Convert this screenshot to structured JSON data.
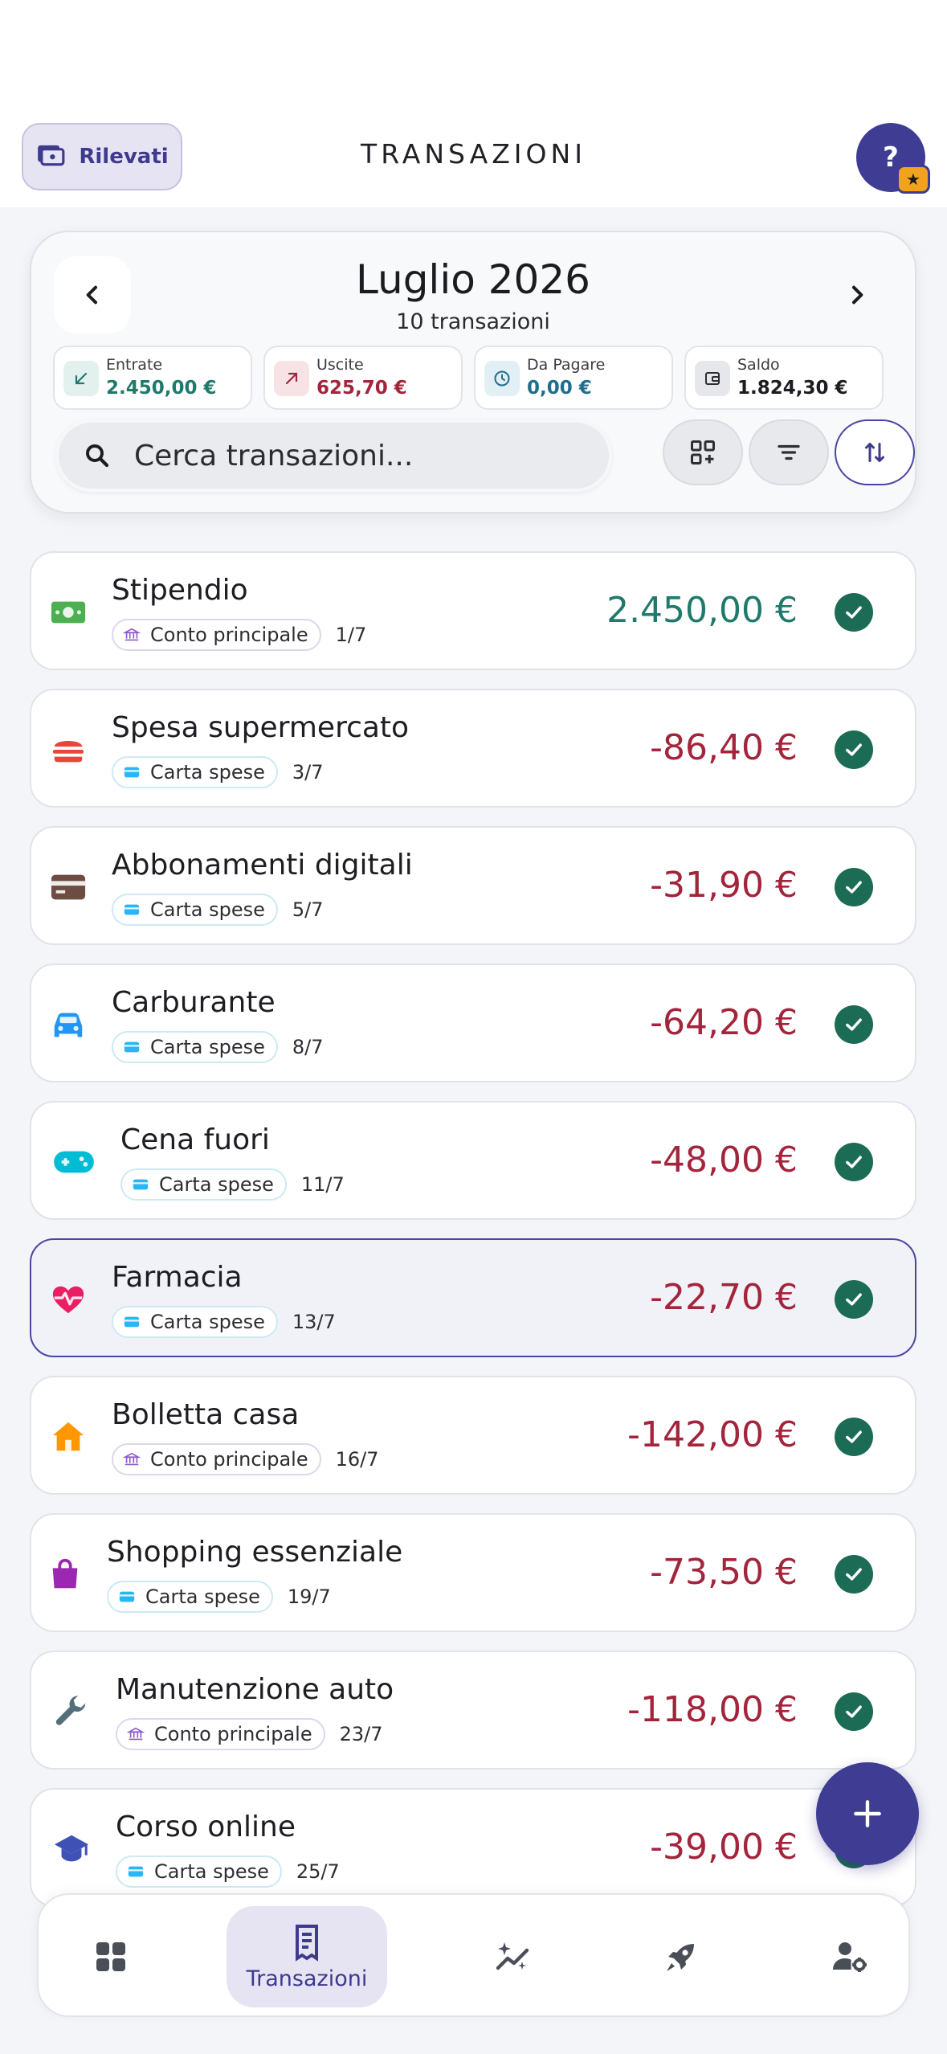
{
  "header": {
    "rilevati_label": "Rilevati",
    "title": "TRANSAZIONI",
    "help_label": "?",
    "help_badge": "★"
  },
  "month": {
    "title": "Luglio 2026",
    "subtitle": "10 transazioni",
    "stats": [
      {
        "label": "Entrate",
        "value": "2.450,00 €",
        "color": "#1f7a6b"
      },
      {
        "label": "Uscite",
        "value": "625,70 €",
        "color": "#a3243b"
      },
      {
        "label": "Da Pagare",
        "value": "0,00 €",
        "color": "#1f6f8b"
      },
      {
        "label": "Saldo",
        "value": "1.824,30 €",
        "color": "#1c1c22"
      }
    ]
  },
  "search": {
    "placeholder": "Cerca transazioni..."
  },
  "transactions": [
    {
      "name": "Stipendio",
      "account": "Conto principale",
      "account_type": "bank",
      "date": "1/7",
      "amount": "2.450,00 €",
      "icon": "banknote-icon",
      "color": "#4caf50"
    },
    {
      "name": "Spesa supermercato",
      "account": "Carta spese",
      "account_type": "card",
      "date": "3/7",
      "amount": "-86,40 €",
      "icon": "burger-icon",
      "color": "#e8453c"
    },
    {
      "name": "Abbonamenti digitali",
      "account": "Carta spese",
      "account_type": "card",
      "date": "5/7",
      "amount": "-31,90 €",
      "icon": "credit-card-icon",
      "color": "#6d4c41"
    },
    {
      "name": "Carburante",
      "account": "Carta spese",
      "account_type": "card",
      "date": "8/7",
      "amount": "-64,20 €",
      "icon": "car-icon",
      "color": "#2196f3"
    },
    {
      "name": "Cena fuori",
      "account": "Carta spese",
      "account_type": "card",
      "date": "11/7",
      "amount": "-48,00 €",
      "icon": "gamepad-icon",
      "color": "#00bcd4"
    },
    {
      "name": "Farmacia",
      "account": "Carta spese",
      "account_type": "card",
      "date": "13/7",
      "amount": "-22,70 €",
      "icon": "heart-pulse-icon",
      "color": "#e91e63"
    },
    {
      "name": "Bolletta casa",
      "account": "Conto principale",
      "account_type": "bank",
      "date": "16/7",
      "amount": "-142,00 €",
      "icon": "house-icon",
      "color": "#ff9800"
    },
    {
      "name": "Shopping essenziale",
      "account": "Carta spese",
      "account_type": "card",
      "date": "19/7",
      "amount": "-73,50 €",
      "icon": "shopping-bag-icon",
      "color": "#9c27b0"
    },
    {
      "name": "Manutenzione auto",
      "account": "Conto principale",
      "account_type": "bank",
      "date": "23/7",
      "amount": "-118,00 €",
      "icon": "wrench-icon",
      "color": "#546e7a"
    },
    {
      "name": "Corso online",
      "account": "Carta spese",
      "account_type": "card",
      "date": "25/7",
      "amount": "-39,00 €",
      "icon": "graduation-cap-icon",
      "color": "#3f51b5"
    }
  ],
  "bottom_nav": {
    "active_label": "Transazioni"
  }
}
